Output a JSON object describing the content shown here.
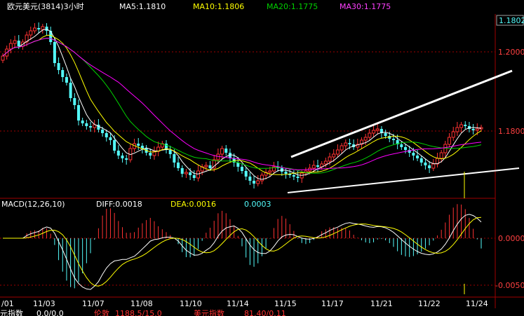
{
  "header": {
    "symbol_label": "欧元美元(3814)3小时",
    "ma5": "MA5:1.1810",
    "ma10": "MA10:1.1806",
    "ma20": "MA20:1.1775",
    "ma30": "MA30:1.1775"
  },
  "price_axis": {
    "current_price": "1.1802",
    "ticks": [
      "1.2000",
      "1.1800"
    ]
  },
  "macd_header": {
    "title": "MACD(12,26,10)",
    "diff": "DIFF:0.0018",
    "dea": "DEA:0.0016",
    "macd": "0.0003"
  },
  "macd_axis": {
    "ticks": [
      "0.0000",
      "-0.0050"
    ]
  },
  "date_axis": {
    "labels": [
      "/01",
      "11/03",
      "11/07",
      "11/08",
      "11/10",
      "11/14",
      "11/15",
      "11/17",
      "11/21",
      "11/22",
      "11/24"
    ]
  },
  "bottom_bar": {
    "left": "元指数",
    "left_value": "0.0/0.0",
    "middle": "伦敦",
    "middle_value": "1188.5/15.0",
    "right": "美元指数",
    "right_value": "81.40/0.11"
  },
  "colors": {
    "up": "#ff3232",
    "down": "#54fcfc",
    "ma5": "#ffffff",
    "ma10": "#ffff00",
    "ma20": "#00d000",
    "ma30": "#ff00ff",
    "axis": "#a00000",
    "grid": "#a00000",
    "header_yellow": "#ffff00"
  },
  "chart_data": [
    {
      "type": "candlestick",
      "title": "欧元美元(3814)3小时",
      "ylim": [
        1.16,
        1.21
      ],
      "yticks": [
        1.2,
        1.18
      ],
      "last_price": 1.1802,
      "series": [
        {
          "name": "MA5",
          "last": 1.181
        },
        {
          "name": "MA10",
          "last": 1.1806
        },
        {
          "name": "MA20",
          "last": 1.1775
        },
        {
          "name": "MA30",
          "last": 1.1775
        }
      ]
    },
    {
      "type": "bar",
      "title": "MACD(12,26,10)",
      "yticks": [
        0.0,
        -0.005
      ],
      "series": [
        {
          "name": "DIFF",
          "last": 0.0018
        },
        {
          "name": "DEA",
          "last": 0.0016
        },
        {
          "name": "MACD",
          "last": 0.0003
        }
      ]
    }
  ]
}
